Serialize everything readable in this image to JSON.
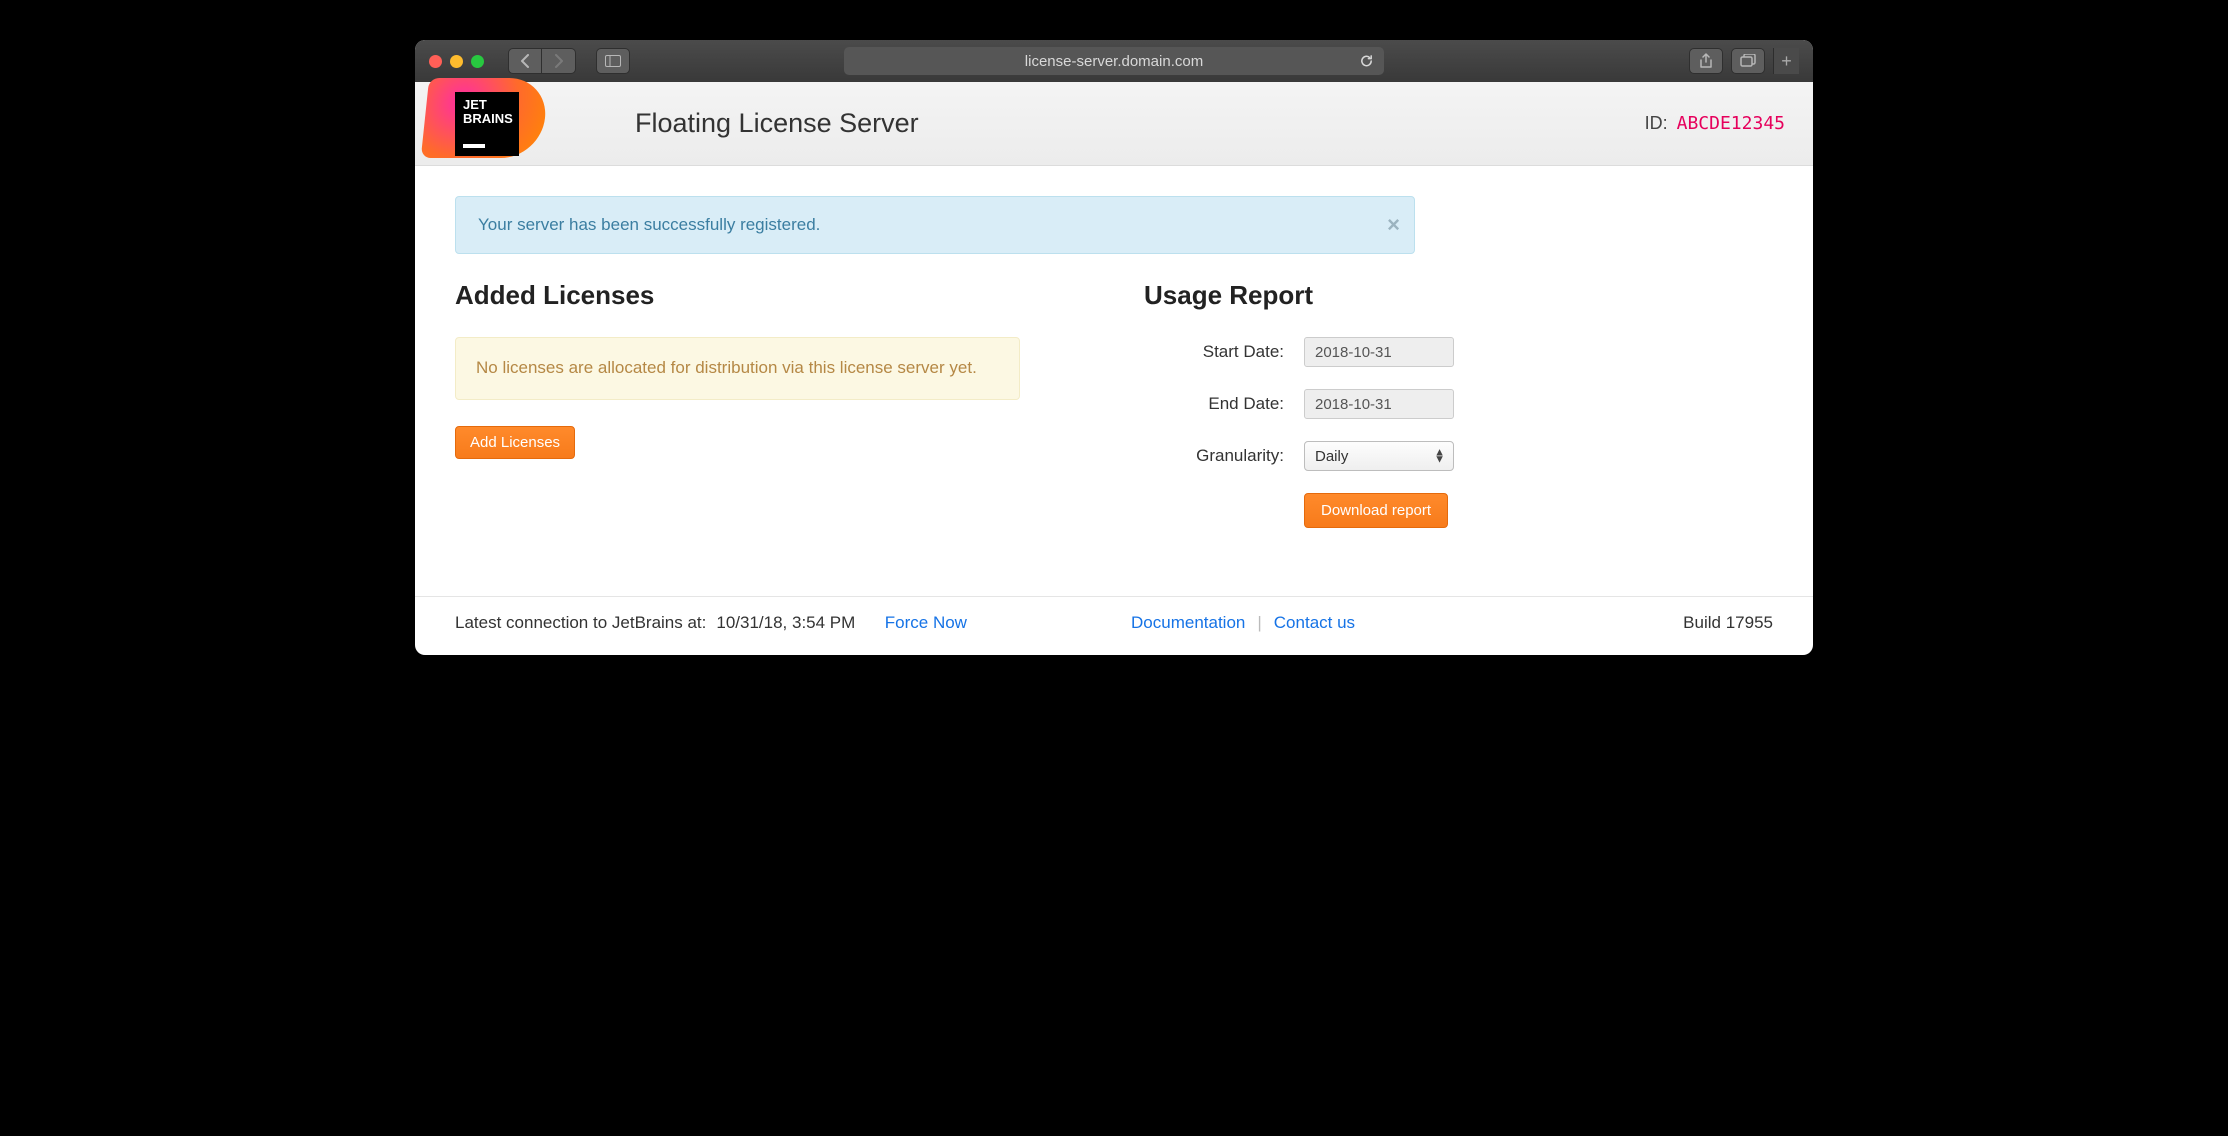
{
  "browser": {
    "address": "license-server.domain.com"
  },
  "header": {
    "app_title": "Floating License Server",
    "logo_text1": "JET",
    "logo_text2": "BRAINS",
    "id_label": "ID:",
    "id_value": "ABCDE12345"
  },
  "alerts": {
    "success": "Your server has been successfully registered.",
    "no_licenses": "No licenses are allocated for distribution via this license server yet."
  },
  "licenses": {
    "heading": "Added Licenses",
    "add_button": "Add Licenses"
  },
  "usage": {
    "heading": "Usage Report",
    "start_label": "Start Date:",
    "start_value": "2018-10-31",
    "end_label": "End Date:",
    "end_value": "2018-10-31",
    "gran_label": "Granularity:",
    "gran_value": "Daily",
    "download_button": "Download report"
  },
  "footer": {
    "latest_conn_label": "Latest connection to JetBrains at:",
    "latest_conn_time": "10/31/18, 3:54 PM",
    "force_now": "Force Now",
    "documentation": "Documentation",
    "contact": "Contact us",
    "build_label": "Build",
    "build_number": "17955"
  }
}
